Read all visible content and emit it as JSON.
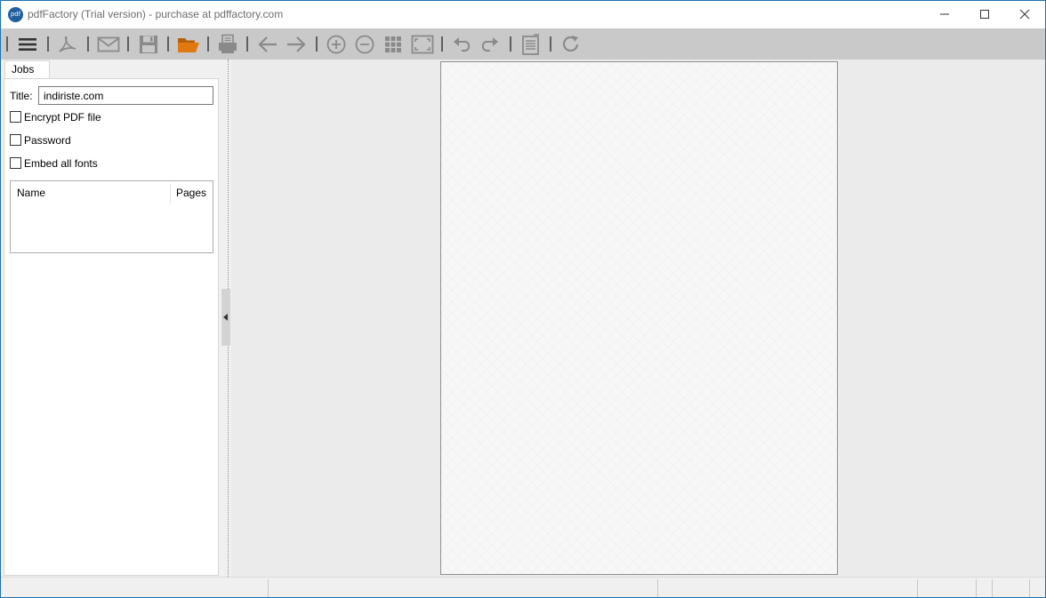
{
  "window": {
    "app_icon_text": "pdf",
    "title": "pdfFactory (Trial version) - purchase at pdffactory.com"
  },
  "toolbar": {
    "buttons": [
      {
        "name": "menu-icon"
      },
      {
        "name": "acrobat-icon"
      },
      {
        "name": "email-icon"
      },
      {
        "name": "save-icon"
      },
      {
        "name": "open-folder-icon"
      },
      {
        "name": "print-icon"
      },
      {
        "name": "back-arrow-icon"
      },
      {
        "name": "forward-arrow-icon"
      },
      {
        "name": "zoom-in-icon"
      },
      {
        "name": "zoom-out-icon"
      },
      {
        "name": "grid-view-icon"
      },
      {
        "name": "fit-page-icon"
      },
      {
        "name": "undo-icon"
      },
      {
        "name": "redo-icon"
      },
      {
        "name": "page-notes-icon"
      },
      {
        "name": "refresh-icon"
      }
    ],
    "accent_color": "#e07a10"
  },
  "left_panel": {
    "tab_label": "Jobs",
    "title_label": "Title:",
    "title_value": "indiriste.com",
    "options": [
      {
        "label": "Encrypt PDF file",
        "checked": false
      },
      {
        "label": "Password",
        "checked": false
      },
      {
        "label": "Embed all fonts",
        "checked": false
      }
    ],
    "job_list": {
      "columns": [
        "Name",
        "Pages"
      ],
      "rows": []
    }
  },
  "status_bar": {
    "panes": [
      "",
      "",
      "",
      "",
      "",
      ""
    ]
  }
}
